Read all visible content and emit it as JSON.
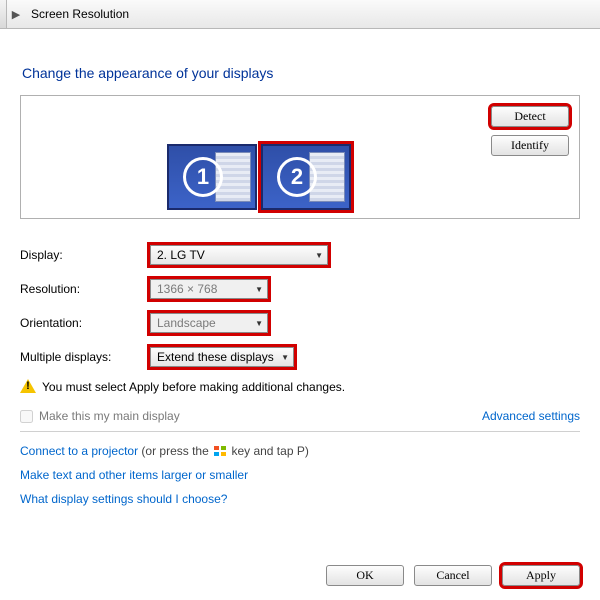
{
  "breadcrumb": {
    "title": "Screen Resolution"
  },
  "heading": "Change the appearance of your displays",
  "preview": {
    "monitors": [
      {
        "number": "1",
        "selected": false
      },
      {
        "number": "2",
        "selected": true
      }
    ],
    "detect_label": "Detect",
    "identify_label": "Identify"
  },
  "form": {
    "display": {
      "label": "Display:",
      "value": "2. LG TV"
    },
    "resolution": {
      "label": "Resolution:",
      "value": "1366 × 768"
    },
    "orientation": {
      "label": "Orientation:",
      "value": "Landscape"
    },
    "multiple": {
      "label": "Multiple displays:",
      "value": "Extend these displays"
    }
  },
  "warning_text": "You must select Apply before making additional changes.",
  "main_display_checkbox_label": "Make this my main display",
  "advanced_link": "Advanced settings",
  "links": {
    "projector_pre": "Connect to a projector",
    "projector_post": " (or press the ",
    "projector_tail": " key and tap P)",
    "textsize": "Make text and other items larger or smaller",
    "which": "What display settings should I choose?"
  },
  "buttons": {
    "ok": "OK",
    "cancel": "Cancel",
    "apply": "Apply"
  }
}
